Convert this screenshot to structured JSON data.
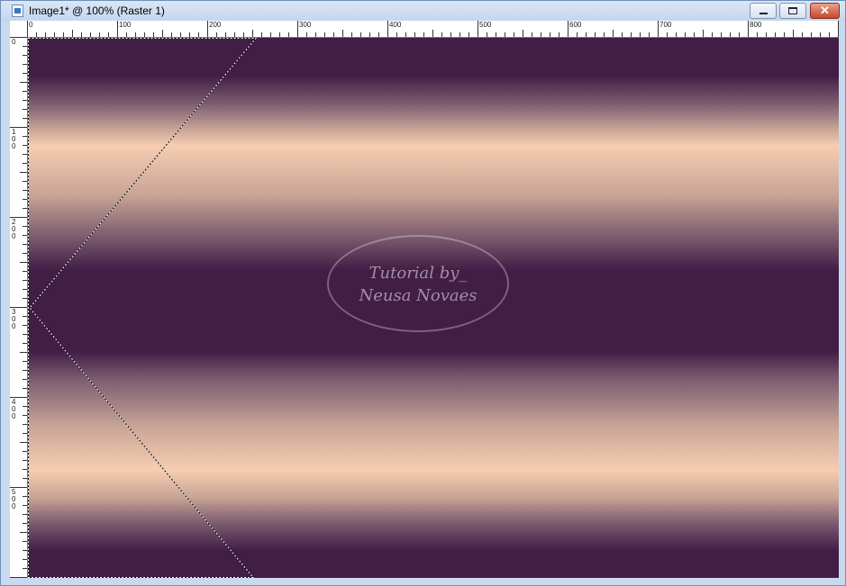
{
  "window": {
    "title": "Image1* @ 100% (Raster 1)",
    "icon": "image-document-icon",
    "controls": {
      "minimize": "minimize-icon",
      "maximize": "maximize-icon",
      "close": "✕"
    }
  },
  "rulers": {
    "horizontal": [
      "0",
      "100",
      "200",
      "300",
      "400",
      "500",
      "600",
      "700",
      "800"
    ],
    "vertical": [
      "0",
      "1\n0\n0",
      "2\n0\n0",
      "3\n0\n0",
      "4\n0\n0",
      "5\n0\n0"
    ]
  },
  "canvas": {
    "zoom": "100%",
    "layer": "Raster 1",
    "colors": {
      "dark": "#421d46",
      "light": "#f6cdb1"
    }
  },
  "watermark": {
    "line1": "Tutorial by_",
    "line2": "Neusa Novaes"
  }
}
